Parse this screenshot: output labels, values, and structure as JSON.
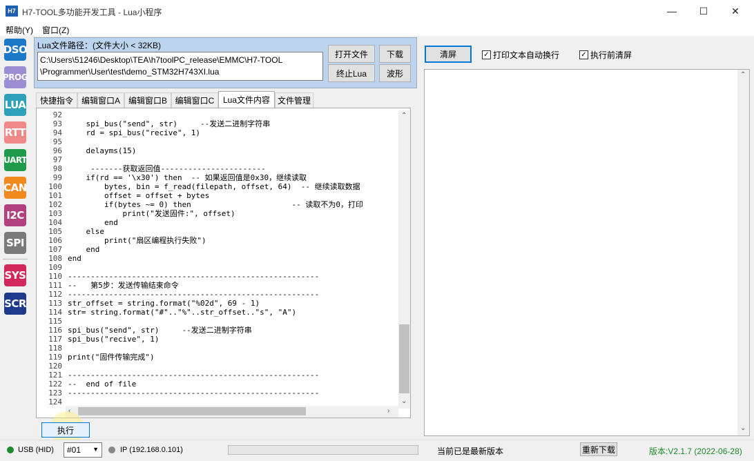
{
  "window": {
    "title": "H7-TOOL多功能开发工具 - Lua小程序",
    "app_icon_text": "H7"
  },
  "menu": [
    "帮助(Y)",
    "窗口(Z)"
  ],
  "left_bar": [
    {
      "label": "DSO",
      "color": "#1e78c8"
    },
    {
      "label": "PROG",
      "color": "#9b8ed3"
    },
    {
      "label": "LUA",
      "color": "#2ea0b8"
    },
    {
      "label": "RTT",
      "color": "#f08a8a"
    },
    {
      "label": "UART",
      "color": "#1e9a4a"
    },
    {
      "label": "CAN",
      "color": "#f08a1e"
    },
    {
      "label": "I2C",
      "color": "#b0407e"
    },
    {
      "label": "SPI",
      "color": "#7a7a7a"
    },
    {
      "label": "SYS",
      "color": "#d0285a"
    },
    {
      "label": "SCR",
      "color": "#1e3a8a"
    }
  ],
  "lua_file": {
    "path_label": "Lua文件路径：(文件大小 < 32KB)",
    "path_line1": "C:\\Users\\51246\\Desktop\\TEA\\h7toolPC_release\\EMMC\\H7-TOOL",
    "path_line2": "\\Programmer\\User\\test\\demo_STM32H743XI.lua",
    "open_button": "打开文件",
    "download_button": "下载",
    "stop_button": "终止Lua",
    "wave_button": "波形"
  },
  "tabs": [
    "快捷指令",
    "编辑窗口A",
    "编辑窗口B",
    "编辑窗口C",
    "Lua文件内容",
    "文件管理"
  ],
  "active_tab": "Lua文件内容",
  "code_lines": [
    {
      "n": "92",
      "t": ""
    },
    {
      "n": "93",
      "t": "    spi_bus(\"send\", str)     --发送二进制字符串"
    },
    {
      "n": "94",
      "t": "    rd = spi_bus(\"recive\", 1)"
    },
    {
      "n": "95",
      "t": ""
    },
    {
      "n": "96",
      "t": "    delayms(15)"
    },
    {
      "n": "97",
      "t": ""
    },
    {
      "n": "98",
      "t": "     -------获取返回值-----------------------"
    },
    {
      "n": "99",
      "t": "    if(rd == '\\x30') then  -- 如果返回值是0x30，继续读取"
    },
    {
      "n": "100",
      "t": "        bytes, bin = f_read(filepath, offset, 64)  -- 继续读取数据"
    },
    {
      "n": "101",
      "t": "        offset = offset + bytes"
    },
    {
      "n": "102",
      "t": "        if(bytes ~= 0) then                      -- 读取不为0，打印"
    },
    {
      "n": "103",
      "t": "            print(\"发送固件:\", offset)"
    },
    {
      "n": "104",
      "t": "        end"
    },
    {
      "n": "105",
      "t": "    else"
    },
    {
      "n": "106",
      "t": "        print(\"扇区编程执行失败\")"
    },
    {
      "n": "107",
      "t": "    end"
    },
    {
      "n": "108",
      "t": "end"
    },
    {
      "n": "109",
      "t": ""
    },
    {
      "n": "110",
      "t": "-------------------------------------------------------"
    },
    {
      "n": "111",
      "t": "--   第5步：发送传输结束命令"
    },
    {
      "n": "112",
      "t": "-------------------------------------------------------"
    },
    {
      "n": "113",
      "t": "str_offset = string.format(\"%02d\", 69 - 1)"
    },
    {
      "n": "114",
      "t": "str= string.format(\"#\"..\"%\"..str_offset..\"s\", \"A\")"
    },
    {
      "n": "115",
      "t": ""
    },
    {
      "n": "116",
      "t": "spi_bus(\"send\", str)     --发送二进制字符串"
    },
    {
      "n": "117",
      "t": "spi_bus(\"recive\", 1)"
    },
    {
      "n": "118",
      "t": ""
    },
    {
      "n": "119",
      "t": "print(\"固件传输完成\")"
    },
    {
      "n": "120",
      "t": ""
    },
    {
      "n": "121",
      "t": "-------------------------------------------------------"
    },
    {
      "n": "122",
      "t": "--  end of file"
    },
    {
      "n": "123",
      "t": "-------------------------------------------------------"
    },
    {
      "n": "124",
      "t": ""
    }
  ],
  "exec_button": "执行",
  "output_panel": {
    "clear_button": "清屏",
    "auto_wrap_label": "打印文本自动换行",
    "auto_wrap_checked": true,
    "clear_before_exec_label": "执行前清屏",
    "clear_before_exec_checked": true
  },
  "status": {
    "usb_label": "USB (HID)",
    "usb_color": "#1e8a2e",
    "device_selected": "#01",
    "ip_label": "IP (192.168.0.101)",
    "ip_color": "#888888",
    "version_msg": "当前已是最新版本",
    "redownload_button": "重新下载",
    "version": "版本:V2.1.7 (2022-06-28)",
    "version_color": "#1e8a2e"
  }
}
